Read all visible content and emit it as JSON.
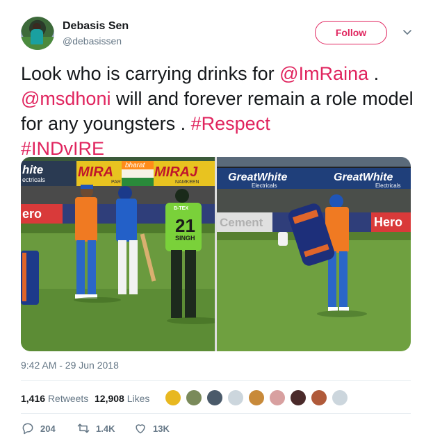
{
  "author": {
    "name": "Debasis Sen",
    "handle": "@debasissen"
  },
  "follow_label": "Follow",
  "tweet": {
    "line1_text": "Look who is carrying drinks for ",
    "mention1": "@ImRaina",
    "line1_end": " .",
    "mention2": "@msdhoni",
    "line2_text": " will and forever remain  a role model for any youngsters . ",
    "hashtag1": "#Respect",
    "hashtag2": "#INDvIRE"
  },
  "media": {
    "left_photo": {
      "board_left_top": "hite",
      "board_left_sub": "ectricals",
      "board_mid_top": "MIRA",
      "board_mid_brand": "bharat",
      "board_mid_sub": "PAR",
      "board_right_top": "MIRAJ",
      "board_right_sub": "NAMKEEN",
      "lower_board_left": "ero",
      "jersey_number": "21",
      "jersey_name": "SINGH",
      "sponsor": "B-TEX"
    },
    "right_photo": {
      "board_left_top": "GreatWhite",
      "board_left_sub": "Electricals",
      "board_right_top": "GreatWhite",
      "board_right_sub": "Electricals",
      "lower_board_left": "Cement",
      "lower_board_right": "Hero"
    }
  },
  "timestamp": "9:42 AM - 29 Jun 2018",
  "stats": {
    "retweets_count": "1,416",
    "retweets_label": "Retweets",
    "likes_count": "12,908",
    "likes_label": "Likes"
  },
  "actions": {
    "replies": "204",
    "retweets": "1.4K",
    "likes": "13K"
  },
  "colors": {
    "accent": "#e0245e",
    "muted": "#657786",
    "text": "#14171a"
  }
}
